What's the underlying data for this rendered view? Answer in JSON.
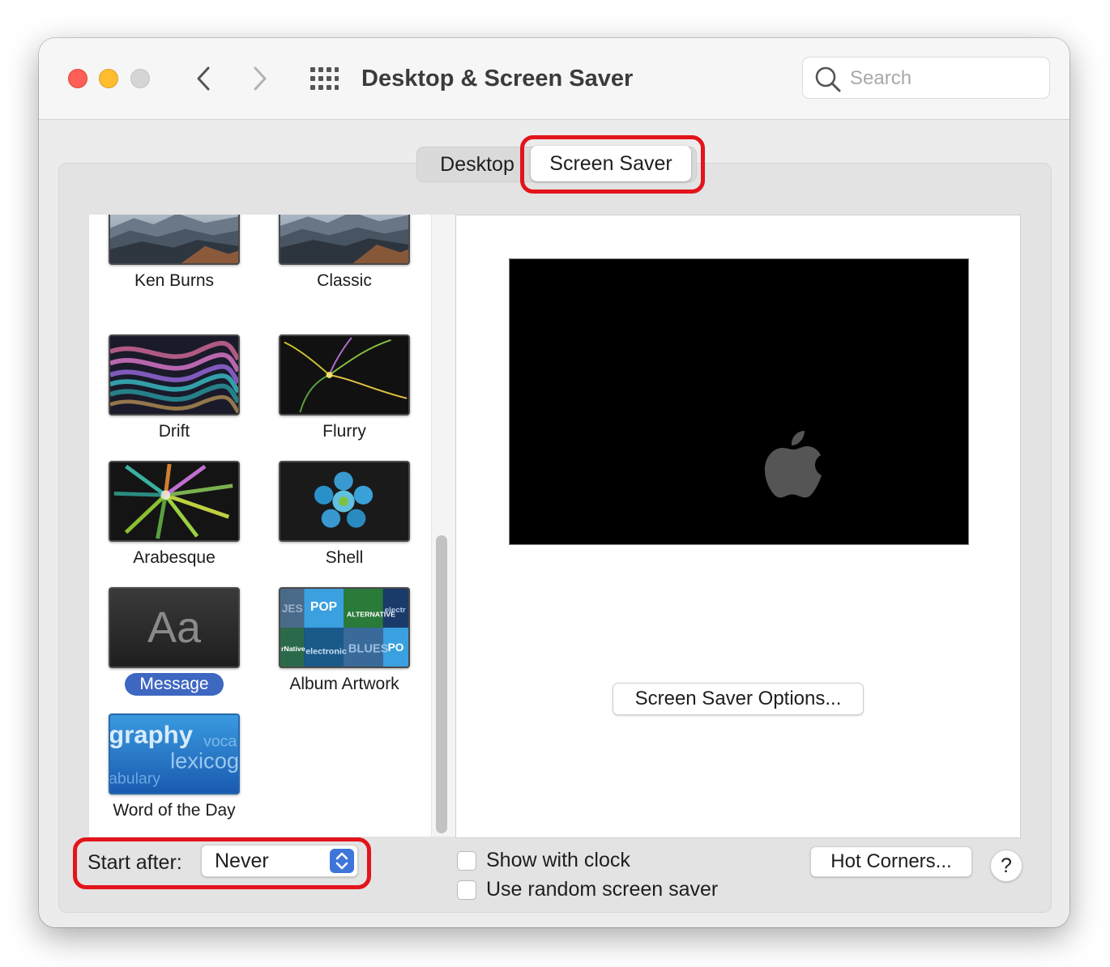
{
  "window": {
    "title": "Desktop & Screen Saver",
    "search_placeholder": "Search"
  },
  "tabs": [
    {
      "label": "Desktop",
      "selected": false
    },
    {
      "label": "Screen Saver",
      "selected": true
    }
  ],
  "screensavers": [
    {
      "label": "Ken Burns",
      "thumb": "mountains",
      "selected": false
    },
    {
      "label": "Classic",
      "thumb": "mountains",
      "selected": false
    },
    {
      "label": "Drift",
      "thumb": "drift-waves",
      "selected": false
    },
    {
      "label": "Flurry",
      "thumb": "flurry",
      "selected": false
    },
    {
      "label": "Arabesque",
      "thumb": "arabesque",
      "selected": false
    },
    {
      "label": "Shell",
      "thumb": "shell",
      "selected": false
    },
    {
      "label": "Message",
      "thumb": "message",
      "thumb_text": "Aa",
      "selected": true
    },
    {
      "label": "Album Artwork",
      "thumb": "album-artwork",
      "selected": false
    },
    {
      "label": "Word of the Day",
      "thumb": "word-of-the-day",
      "selected": false
    }
  ],
  "album_artwork_words": [
    "JES",
    "POP",
    "ALTERNATIVE",
    "electr",
    "rNative",
    "electronic",
    "BLUES",
    "PO"
  ],
  "word_of_day_words": [
    "graphy",
    "voca",
    "lexicog",
    "abulary"
  ],
  "preview": {
    "background": "#000000",
    "logo": "apple-logo"
  },
  "options_button": "Screen Saver Options...",
  "start_after": {
    "label": "Start after:",
    "value": "Never"
  },
  "checkboxes": [
    {
      "label": "Show with clock",
      "checked": false
    },
    {
      "label": "Use random screen saver",
      "checked": false
    }
  ],
  "hot_corners_button": "Hot Corners...",
  "help_button": "?",
  "colors": {
    "highlight": "#e3141b",
    "selection": "#3e67c1",
    "close": "#fe5f57",
    "minimize": "#febc2e",
    "zoom_disabled": "#d5d5d5"
  }
}
